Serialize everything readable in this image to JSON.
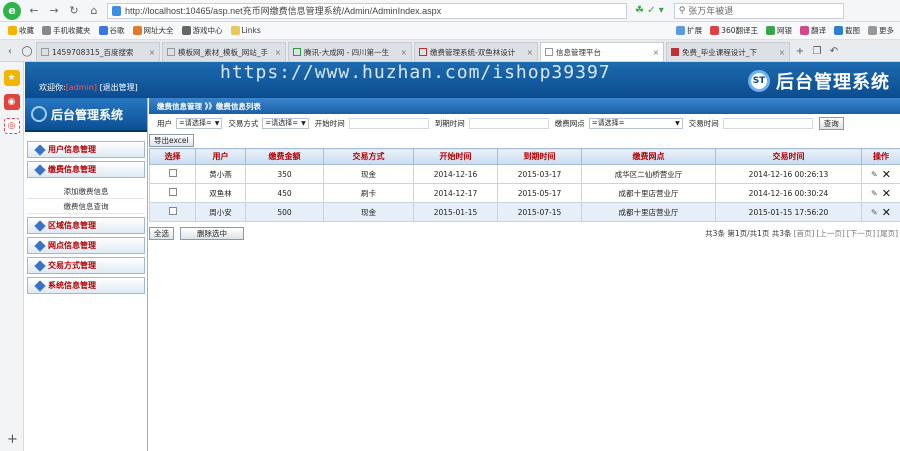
{
  "browser": {
    "url": "http://localhost:10465/asp.net充币网缴费信息管理系统/Admin/AdminIndex.aspx",
    "search_placeholder": "张万年被退",
    "favorites": [
      "收藏",
      "手机收藏夹",
      "谷歌",
      "网址大全",
      "游戏中心",
      "Links"
    ],
    "favorites_right": [
      "扩展",
      "360翻译王",
      "网银",
      "翻译",
      "截图",
      "更多"
    ],
    "tabs": [
      {
        "label": "1459708315_百度搜索",
        "active": false
      },
      {
        "label": "模板网_素材_模板_网站_手",
        "active": false
      },
      {
        "label": "腾讯-大成网 - 四川第一生",
        "active": false
      },
      {
        "label": "缴费管理系统-双鱼林设计",
        "active": false
      },
      {
        "label": "信息管理平台",
        "active": true
      },
      {
        "label": "免费_毕业课程设计_下",
        "active": false
      }
    ]
  },
  "watermark": "https://www.huzhan.com/ishop39397",
  "header": {
    "welcome_prefix": "欢迎你:",
    "admin_name": "[admin]",
    "logout": "[退出管理]",
    "title": "后台管理系统",
    "logo_text": "ST"
  },
  "sidebar": {
    "logo_title": "后台管理系统",
    "items": [
      {
        "label": "用户信息管理"
      },
      {
        "label": "缴费信息管理"
      }
    ],
    "sub_items": [
      "添加缴费信息",
      "缴费信息查询"
    ],
    "items2": [
      {
        "label": "区域信息管理"
      },
      {
        "label": "网点信息管理"
      },
      {
        "label": "交易方式管理"
      },
      {
        "label": "系统信息管理"
      }
    ]
  },
  "breadcrumb": "缴费信息管理 》》缴费信息列表",
  "filter": {
    "user_label": "用户",
    "user_select": "=请选择=",
    "method_label": "交易方式",
    "method_select": "=请选择=",
    "start_label": "开始时间",
    "end_label": "到期时间",
    "site_label": "缴费网点",
    "site_select": "=请选择=",
    "trade_label": "交易时间",
    "query_button": "查询",
    "export_button": "导出excel"
  },
  "table": {
    "headers": [
      "选择",
      "用户",
      "缴费金额",
      "交易方式",
      "开始时间",
      "到期时间",
      "缴费网点",
      "交易时间",
      "操作"
    ],
    "rows": [
      [
        "",
        "黄小燕",
        "350",
        "现金",
        "2014-12-16",
        "2015-03-17",
        "成华区二仙桥营业厅",
        "2014-12-16 00:26:13"
      ],
      [
        "",
        "双鱼林",
        "450",
        "刷卡",
        "2014-12-17",
        "2015-05-17",
        "成都十里店营业厅",
        "2014-12-16 00:30:24"
      ],
      [
        "",
        "周小安",
        "500",
        "现金",
        "2015-01-15",
        "2015-07-15",
        "成都十里店营业厅",
        "2015-01-15 17:56:20"
      ]
    ]
  },
  "footer": {
    "select_all": "全选",
    "delete_selected": "删除选中",
    "pager_info": "共3条 第1页/共1页 共3条",
    "pager_links": [
      "[首页]",
      "[上一页]",
      "[下一页]",
      "[尾页]"
    ]
  }
}
